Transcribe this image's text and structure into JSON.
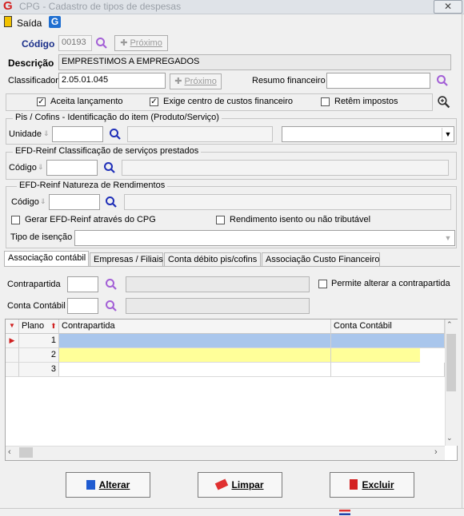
{
  "window": {
    "title": "CPG - Cadastro de tipos de despesas"
  },
  "toolbar": {
    "exit_label": "Saída"
  },
  "codigo": {
    "label": "Código",
    "value": "00193",
    "next_label": "Próximo"
  },
  "descricao": {
    "label": "Descrição",
    "value": "EMPRESTIMOS A EMPREGADOS"
  },
  "classificador": {
    "label": "Classificador",
    "value": "2.05.01.045",
    "next_label": "Próximo",
    "resumo_label": "Resumo financeiro",
    "resumo_value": ""
  },
  "options": {
    "aceita": {
      "label": "Aceita lançamento",
      "checked": true
    },
    "exige": {
      "label": "Exige centro de custos financeiro",
      "checked": true
    },
    "retem": {
      "label": "Retêm impostos",
      "checked": false
    }
  },
  "pis": {
    "title": "Pis / Cofins - Identificação do item (Produto/Serviço)",
    "unidade_label": "Unidade"
  },
  "efd_class": {
    "title": "EFD-Reinf Classificação de serviços prestados",
    "codigo_label": "Código"
  },
  "efd_nat": {
    "title": "EFD-Reinf Natureza de Rendimentos",
    "codigo_label": "Código",
    "gerar_label": "Gerar EFD-Reinf através do CPG",
    "rend_label": "Rendimento isento ou não tributável",
    "tipo_label": "Tipo de isenção"
  },
  "tabs": [
    "Associação contábil",
    "Empresas / Filiais",
    "Conta débito pis/cofins",
    "Associação Custo Financeiro"
  ],
  "assoc": {
    "contrapartida_label": "Contrapartida",
    "conta_label": "Conta Contábil",
    "permite_label": "Permite alterar a contrapartida"
  },
  "grid": {
    "headers": {
      "plano": "Plano",
      "contrapartida": "Contrapartida",
      "conta": "Conta Contábil"
    },
    "rows": [
      {
        "plano": "1",
        "contrapartida": "",
        "conta": ""
      },
      {
        "plano": "2",
        "contrapartida": "",
        "conta": ""
      },
      {
        "plano": "3",
        "contrapartida": "",
        "conta": ""
      }
    ]
  },
  "buttons": {
    "alterar": "Alterar",
    "limpar": "Limpar",
    "excluir": "Excluir"
  },
  "colors": {
    "selected_row": "#a9c6ec",
    "edit_row": "#ffff99",
    "accent": "#1f6fd1"
  }
}
